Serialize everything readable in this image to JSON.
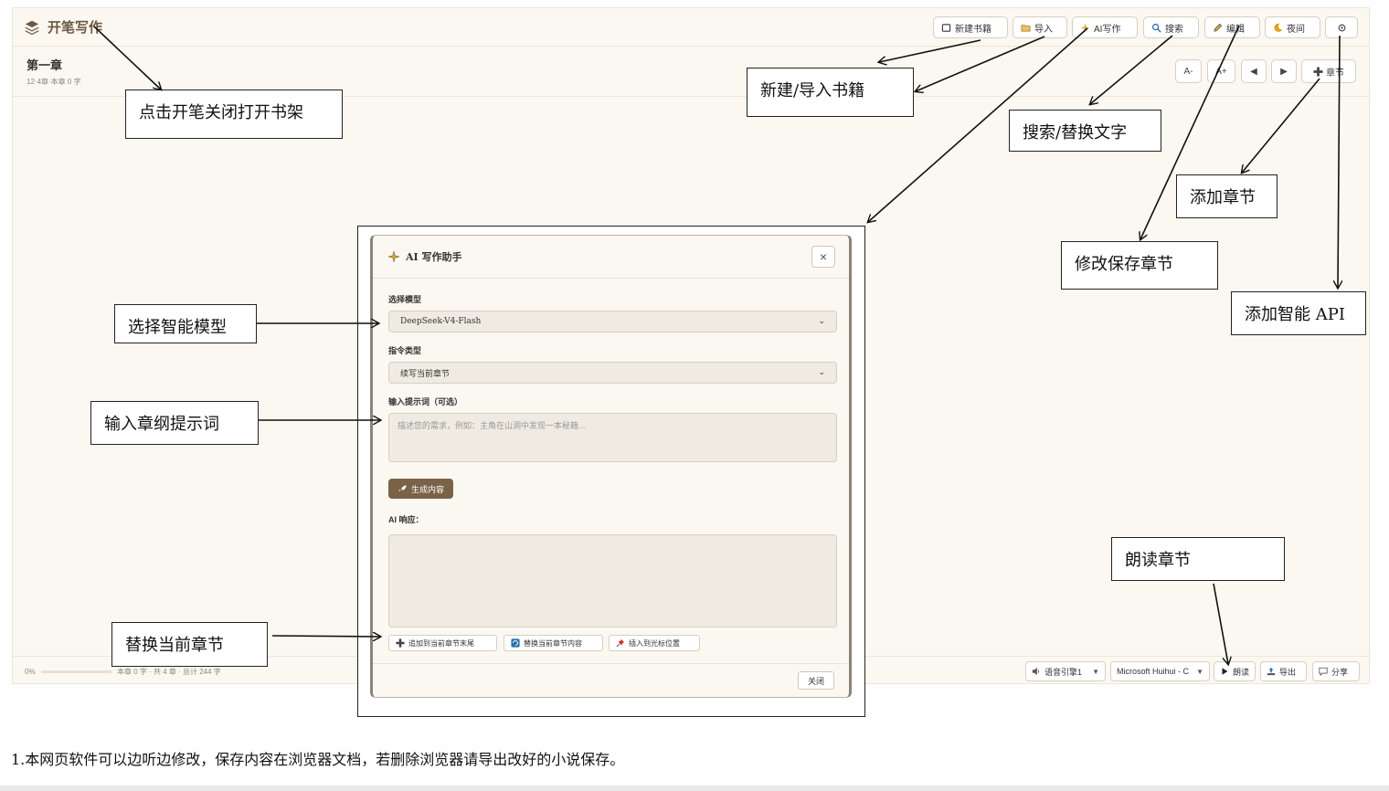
{
  "brand": {
    "name": "开笔写作",
    "icon": "layers-icon"
  },
  "toolbar": [
    {
      "id": "new-book",
      "label": "新建书籍",
      "icon": "square-icon"
    },
    {
      "id": "import",
      "label": "导入",
      "icon": "folder-icon"
    },
    {
      "id": "ai-write",
      "label": "AI写作",
      "icon": "sparkle-icon"
    },
    {
      "id": "search",
      "label": "搜索",
      "icon": "magnifier-icon"
    },
    {
      "id": "edit",
      "label": "编辑",
      "icon": "pencil-icon"
    },
    {
      "id": "night",
      "label": "夜间",
      "icon": "moon-icon"
    },
    {
      "id": "settings",
      "label": "",
      "icon": "gear-icon"
    }
  ],
  "chapter": {
    "title": "第一章",
    "meta": "12·4章·本章 0 字"
  },
  "nav": {
    "font_minus": "A-",
    "font_plus": "A+",
    "prev": "◀",
    "next": "▶",
    "add_chapter": "章节"
  },
  "footer": {
    "progress_text": "0%",
    "progress": 0,
    "stats": "本章 0 字 · 共 4 章 · 总计 244 字",
    "voice": "语音引擎1",
    "voice_name": "Microsoft Huihui - C",
    "read": "朗读",
    "export": "导出",
    "share": "分享"
  },
  "modal": {
    "title": "AI 写作助手",
    "close_x": "×",
    "model_label": "选择模型",
    "model_value": "DeepSeek-V4-Flash",
    "cmd_label": "指令类型",
    "cmd_value": "续写当前章节",
    "prompt_label": "输入提示词（可选）",
    "prompt_placeholder": "描述您的需求，例如：主角在山洞中发现一本秘籍...",
    "generate": "生成内容",
    "response_label": "AI 响应：",
    "append": "追加到当前章节末尾",
    "replace": "替换当前章节内容",
    "insert": "插入到光标位置",
    "close": "关闭"
  },
  "annotations": {
    "shelf": "点击开笔关闭打开书架",
    "new_import": "新建/导入书籍",
    "search_replace": "搜索/替换文字",
    "add_chapter": "添加章节",
    "save_chapter": "修改保存章节",
    "add_api": "添加智能 API",
    "choose_model": "选择智能模型",
    "input_prompt": "输入章纲提示词",
    "replace_chapter": "替换当前章节",
    "read_chapter": "朗读章节"
  },
  "note": "1.本网页软件可以边听边修改，保存内容在浏览器文档，若删除浏览器请导出改好的小说保存。"
}
